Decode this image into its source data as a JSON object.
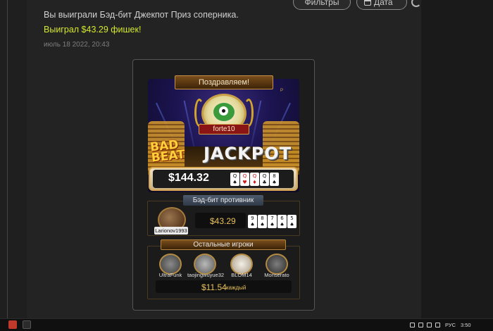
{
  "toolbar": {
    "filters_label": "Фильтры",
    "date_label": "Дата"
  },
  "message": {
    "text": "Вы выиграли Бэд-бит Джекпот Приз соперника.",
    "win_text": "Выиграл $43.29 фишек!",
    "timestamp": "июль 18 2022, 20:43"
  },
  "jackpot_card": {
    "banner_title": "Поздравляем!",
    "brand_mark": "P",
    "winner_name": "forte10",
    "logo_word_1": "BAD",
    "logo_word_2": "BEAT",
    "logo_word_3": "JACKPOT",
    "total_amount": "$144.32",
    "jackpot_hand": [
      {
        "rank": "Q",
        "suit": "♠",
        "color": "black"
      },
      {
        "rank": "Q",
        "suit": "♥",
        "color": "red"
      },
      {
        "rank": "Q",
        "suit": "♦",
        "color": "red"
      },
      {
        "rank": "Q",
        "suit": "♣",
        "color": "black"
      },
      {
        "rank": "8",
        "suit": "♠",
        "color": "black"
      }
    ],
    "opponent_section_label": "Бэд-бит противник",
    "opponent_name": "Larionov1993",
    "opponent_amount": "$43.29",
    "opponent_hand": [
      {
        "rank": "9",
        "suit": "♠",
        "color": "black"
      },
      {
        "rank": "8",
        "suit": "♠",
        "color": "black"
      },
      {
        "rank": "7",
        "suit": "♠",
        "color": "black"
      },
      {
        "rank": "6",
        "suit": "♠",
        "color": "black"
      },
      {
        "rank": "5",
        "suit": "♠",
        "color": "black"
      }
    ],
    "others_section_label": "Остальные игроки",
    "other_players": [
      "UltraFunk",
      "taojingwuyue32",
      "BLOM14",
      "Monserato"
    ],
    "share_amount": "$11.54",
    "share_suffix": "каждый"
  },
  "taskbar": {
    "language": "РУС",
    "time": "3:50"
  }
}
